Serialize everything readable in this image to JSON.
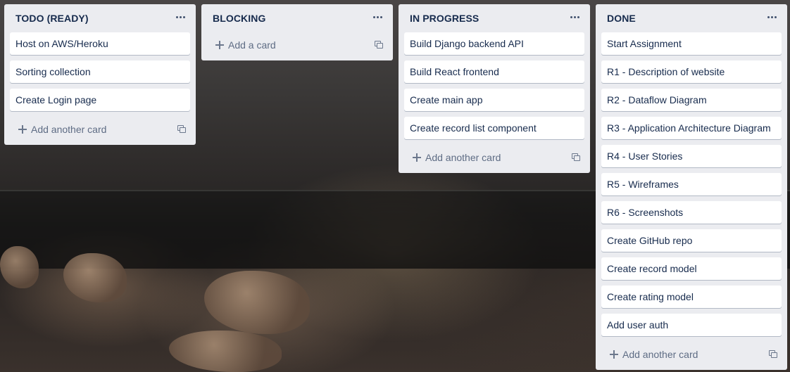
{
  "lists": [
    {
      "title": "TODO (READY)",
      "cards": [
        "Host on AWS/Heroku",
        "Sorting collection",
        "Create Login page"
      ],
      "composer_label": "Add another card"
    },
    {
      "title": "BLOCKING",
      "cards": [],
      "composer_label": "Add a card"
    },
    {
      "title": "IN PROGRESS",
      "cards": [
        "Build Django backend API",
        "Build React frontend",
        "Create main app",
        "Create record list component"
      ],
      "composer_label": "Add another card"
    },
    {
      "title": "DONE",
      "cards": [
        "Start Assignment",
        "R1 - Description of website",
        "R2 - Dataflow Diagram",
        "R3 - Application Architecture Diagram",
        "R4 - User Stories",
        "R5 - Wireframes",
        "R6 - Screenshots",
        "Create GitHub repo",
        "Create record model",
        "Create rating model",
        "Add user auth"
      ],
      "composer_label": "Add another card"
    }
  ],
  "icons": {
    "list_menu": "ellipsis-icon",
    "add": "plus-icon",
    "template": "card-template-icon"
  },
  "colors": {
    "list_bg": "#ebecf0",
    "card_bg": "#ffffff",
    "text": "#172b4d",
    "muted_text": "#5e6c84"
  }
}
